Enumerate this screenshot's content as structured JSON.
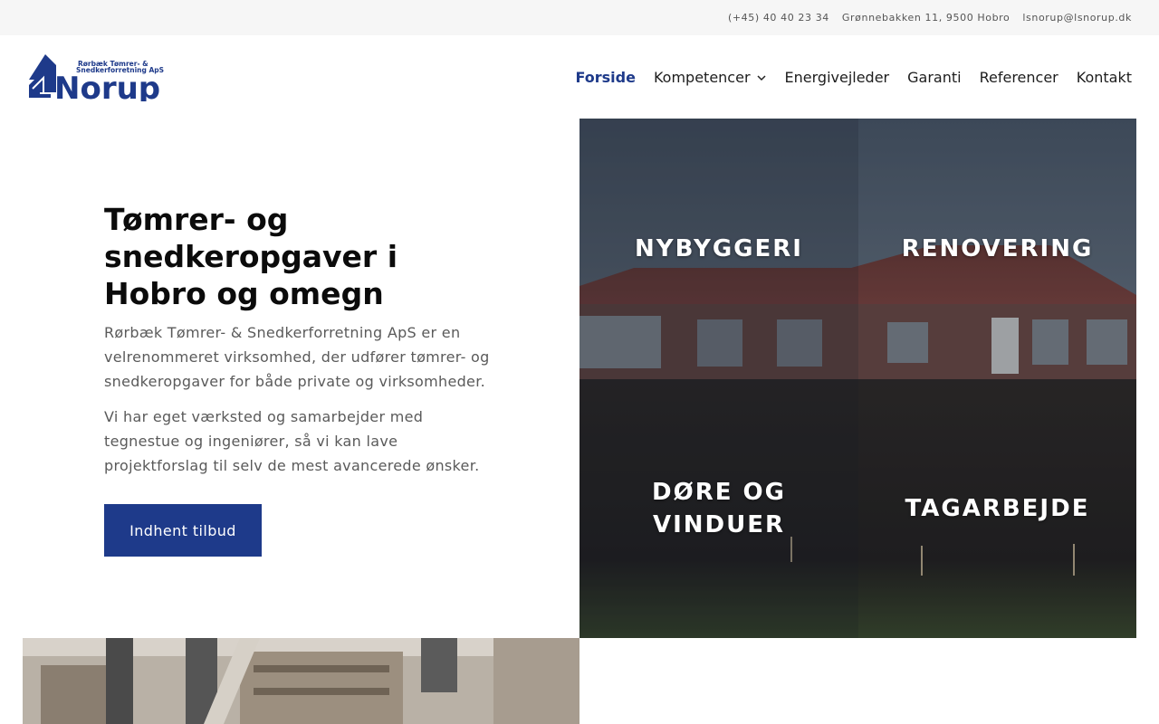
{
  "topbar": {
    "phone": "(+45) 40 40 23 34",
    "address": "Grønnebakken 11, 9500 Hobro",
    "email": "lsnorup@lsnorup.dk"
  },
  "logo": {
    "tagline_line1": "Rørbæk Tømrer- &",
    "tagline_line2": "Snedkerforretning ApS",
    "wordmark": "Norup",
    "brand_color": "#1e3a8a"
  },
  "nav": {
    "items": [
      {
        "label": "Forside",
        "active": true
      },
      {
        "label": "Kompetencer",
        "has_dropdown": true
      },
      {
        "label": "Energivejleder"
      },
      {
        "label": "Garanti"
      },
      {
        "label": "Referencer"
      },
      {
        "label": "Kontakt"
      }
    ]
  },
  "hero": {
    "title": "Tømrer- og snedkeropgaver i Hobro og omegn",
    "paragraph1": "Rørbæk Tømrer- & Snedkerforretning ApS er en velrenommeret virksomhed, der udfører tømrer- og snedkeropgaver for både private og virksomheder.",
    "paragraph2": "Vi har eget værksted og samarbejder med tegnestue og ingeniører, så vi kan lave projektforslag til selv de mest avancerede ønsker.",
    "cta_label": "Indhent tilbud",
    "cta_color": "#1e3a8a"
  },
  "services": {
    "tiles": [
      {
        "label": "NYBYGGERI"
      },
      {
        "label": "RENOVERING"
      },
      {
        "label": "DØRE OG VINDUER"
      },
      {
        "label": "TAGARBEJDE"
      }
    ]
  },
  "icons": {
    "dropdown": "chevron-down-icon"
  }
}
